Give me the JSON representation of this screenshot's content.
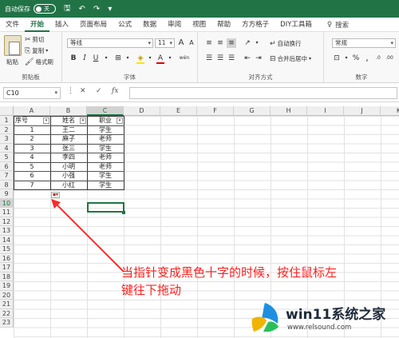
{
  "titlebar": {
    "autosave_label": "自动保存",
    "autosave_state": "关",
    "icons": [
      "save-icon",
      "undo-icon",
      "redo-icon"
    ],
    "doc_name": "",
    "search_label": "搜索"
  },
  "tabs": [
    "文件",
    "开始",
    "插入",
    "页面布局",
    "公式",
    "数据",
    "审阅",
    "视图",
    "帮助",
    "方方格子",
    "DIY工具箱"
  ],
  "tab_active": "开始",
  "tab_search": "搜索",
  "ribbon": {
    "clipboard": {
      "paste": "粘贴",
      "cut": "剪切",
      "copy": "复制",
      "format_painter": "格式刷",
      "label": "剪贴板"
    },
    "font": {
      "font_name": "等线",
      "font_size": "11",
      "bold": "B",
      "italic": "I",
      "underline": "U",
      "grow": "A",
      "shrink": "A",
      "wen": "wén",
      "label": "字体"
    },
    "alignment": {
      "wrap": "自动换行",
      "merge": "合并后居中",
      "label": "对齐方式"
    },
    "number": {
      "format": "常规",
      "label": "数字"
    }
  },
  "formula_bar": {
    "name_box": "C10",
    "cancel": "✕",
    "enter": "✓",
    "fx": "fx"
  },
  "columns": [
    "A",
    "B",
    "C",
    "D",
    "E",
    "F",
    "G",
    "H",
    "I",
    "J",
    "K"
  ],
  "rows": [
    "1",
    "2",
    "3",
    "4",
    "5",
    "6",
    "7",
    "8",
    "9",
    "10",
    "11",
    "12",
    "13",
    "14",
    "15",
    "16",
    "17",
    "18",
    "19",
    "20",
    "21",
    "22",
    "23"
  ],
  "table": {
    "headers": [
      "序号",
      "姓名",
      "职业"
    ],
    "rows": [
      [
        "1",
        "王二",
        "学生"
      ],
      [
        "2",
        "麻子",
        "老师"
      ],
      [
        "3",
        "张三",
        "学生"
      ],
      [
        "4",
        "李四",
        "老师"
      ],
      [
        "5",
        "小明",
        "老师"
      ],
      [
        "6",
        "小强",
        "学生"
      ],
      [
        "7",
        "小红",
        "学生"
      ]
    ]
  },
  "annotation": {
    "line1": "当指针变成黑色十字的时候，按住鼠标左",
    "line2": "键往下拖动",
    "color": "#ff1f1f"
  },
  "watermark": {
    "title": "win11系统之家",
    "url": "www.relsound.com"
  },
  "colors": {
    "excel_green": "#217346",
    "annotation_red": "#ff1f1f"
  }
}
